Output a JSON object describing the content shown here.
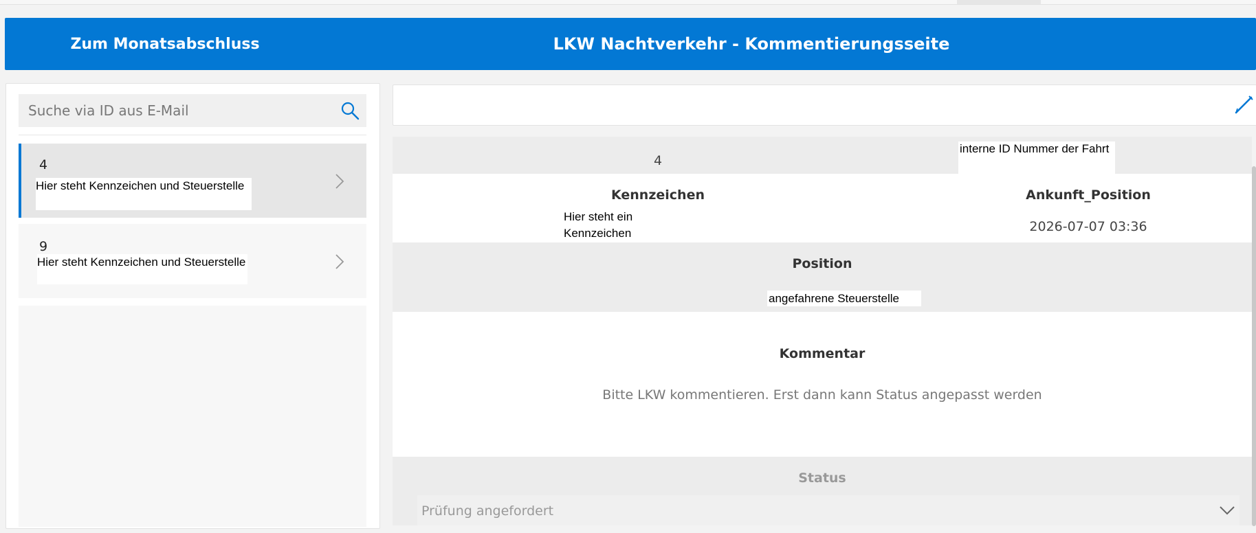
{
  "header": {
    "back_label": "Zum Monatsabschluss",
    "title": "LKW Nachtverkehr - Kommentierungsseite"
  },
  "search": {
    "placeholder": "Suche via ID aus E-Mail",
    "icon": "search-icon"
  },
  "list": {
    "items": [
      {
        "id": "4",
        "subtitle": "Hier steht Kennzeichen und Steuerstelle",
        "selected": true
      },
      {
        "id": "9",
        "subtitle": "Hier steht Kennzeichen und Steuerstelle",
        "selected": false
      }
    ]
  },
  "toolbar": {
    "edit_icon": "pencil-icon"
  },
  "detail": {
    "id_value": "4",
    "id_note": "interne ID Nummer der Fahrt",
    "kennzeichen_label": "Kennzeichen",
    "kennzeichen_value_line1": "Hier steht ein",
    "kennzeichen_value_line2": "Kennzeichen",
    "ankunft_label": "Ankunft_Position",
    "ankunft_value": "2026-07-07 03:36",
    "position_label": "Position",
    "position_value": "angefahrene Steuerstelle",
    "kommentar_label": "Kommentar",
    "kommentar_hint": "Bitte LKW kommentieren. Erst dann kann Status angepasst werden",
    "status_label": "Status",
    "status_value": "Prüfung angefordert"
  },
  "colors": {
    "accent": "#0378d4",
    "band_grey": "#ececec",
    "panel_grey": "#f7f7f7"
  }
}
